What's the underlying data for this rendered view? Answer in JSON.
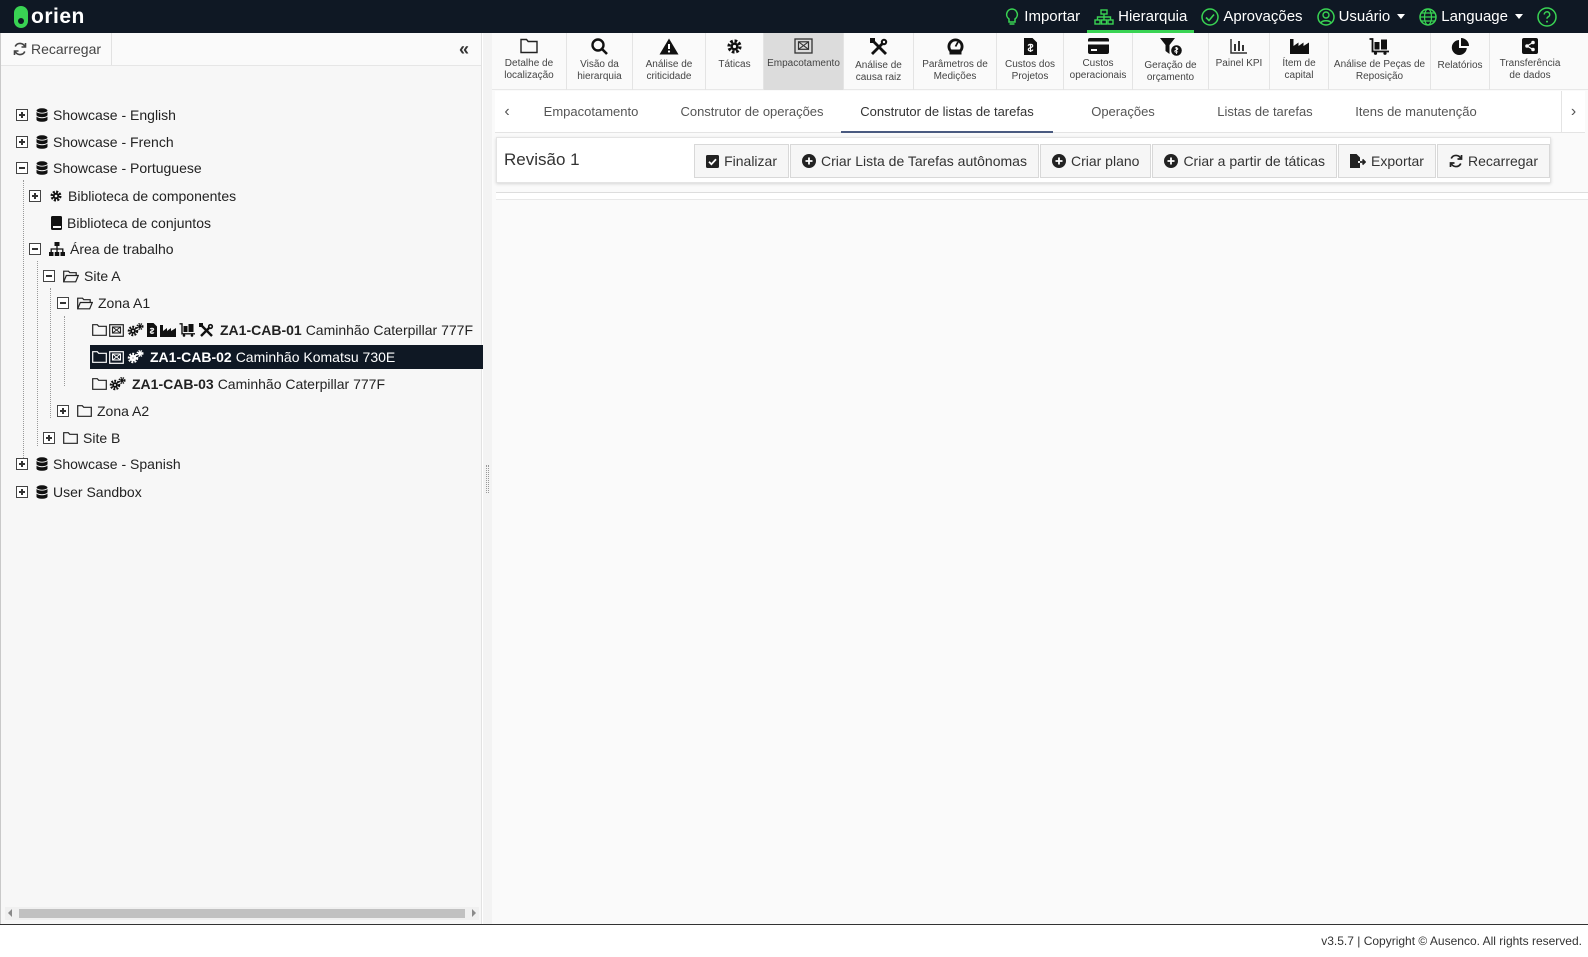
{
  "app": {
    "logo_text": "orien",
    "brand_color": "#39d353",
    "header_bg": "#0f1824"
  },
  "topnav": [
    {
      "label": "Importar",
      "icon": "lightbulb-icon"
    },
    {
      "label": "Hierarquia",
      "icon": "sitemap-icon",
      "active": true
    },
    {
      "label": "Aprovações",
      "icon": "check-circle-icon"
    },
    {
      "label": "Usuário",
      "icon": "user-icon",
      "dropdown": true
    },
    {
      "label": "Language",
      "icon": "globe-icon",
      "dropdown": true
    },
    {
      "label": "",
      "icon": "help-icon"
    }
  ],
  "left": {
    "reload_label": "Recarregar",
    "collapse_glyph": "«",
    "tree": [
      {
        "label": "Showcase - English"
      },
      {
        "label": "Showcase - French"
      },
      {
        "label": "Showcase - Portuguese"
      },
      {
        "label": "Biblioteca de componentes"
      },
      {
        "label": "Biblioteca de conjuntos"
      },
      {
        "label": "Área de trabalho"
      },
      {
        "label": "Site A"
      },
      {
        "label": "Zona A1"
      },
      {
        "code": "ZA1-CAB-01",
        "label": "Caminhão Caterpillar 777F"
      },
      {
        "code": "ZA1-CAB-02",
        "label": "Caminhão Komatsu 730E",
        "selected": true
      },
      {
        "code": "ZA1-CAB-03",
        "label": "Caminhão Caterpillar 777F"
      },
      {
        "label": "Zona A2"
      },
      {
        "label": "Site B"
      },
      {
        "label": "Showcase - Spanish"
      },
      {
        "label": "User Sandbox"
      }
    ]
  },
  "modules": [
    {
      "label": "Detalhe de\nlocalização",
      "icon": "folder-icon"
    },
    {
      "label": "Visão da\nhierarquia",
      "icon": "search-icon"
    },
    {
      "label": "Análise de\ncriticidade",
      "icon": "warning-icon"
    },
    {
      "label": "Táticas",
      "icon": "gear-icon"
    },
    {
      "label": "Empacotamento",
      "icon": "package-icon",
      "active": true
    },
    {
      "label": "Análise de\ncausa raiz",
      "icon": "tools-icon"
    },
    {
      "label": "Parâmetros de\nMedições",
      "icon": "gauge-icon"
    },
    {
      "label": "Custos dos\nProjetos",
      "icon": "invoice-icon"
    },
    {
      "label": "Custos\noperacionais",
      "icon": "credit-card-icon"
    },
    {
      "label": "Geração de\norçamento",
      "icon": "funnel-dollar-icon"
    },
    {
      "label": "Painel KPI",
      "icon": "bar-chart-icon"
    },
    {
      "label": "Ítem de\ncapital",
      "icon": "industry-icon"
    },
    {
      "label": "Análise de Peças de\nReposição",
      "icon": "cart-icon"
    },
    {
      "label": "Relatórios",
      "icon": "pie-chart-icon"
    },
    {
      "label": "Transferência\nde dados",
      "icon": "share-icon"
    }
  ],
  "tabs": [
    {
      "label": "Empacotamento"
    },
    {
      "label": "Construtor de operações"
    },
    {
      "label": "Construtor de listas de tarefas",
      "active": true
    },
    {
      "label": "Operações"
    },
    {
      "label": "Listas de tarefas"
    },
    {
      "label": "Itens de manutenção"
    }
  ],
  "tab_arrows": {
    "left": "‹",
    "right": "›"
  },
  "card": {
    "title": "Revisão 1",
    "actions": [
      {
        "label": "Finalizar",
        "icon": "check-square-icon"
      },
      {
        "label": "Criar Lista de Tarefas autônomas",
        "icon": "plus-circle-icon"
      },
      {
        "label": "Criar plano",
        "icon": "plus-circle-icon"
      },
      {
        "label": "Criar a partir de táticas",
        "icon": "plus-circle-icon"
      },
      {
        "label": "Exportar",
        "icon": "file-export-icon"
      },
      {
        "label": "Recarregar",
        "icon": "refresh-icon"
      }
    ]
  },
  "footer": {
    "text": "v3.5.7 | Copyright © Ausenco. All rights reserved."
  }
}
